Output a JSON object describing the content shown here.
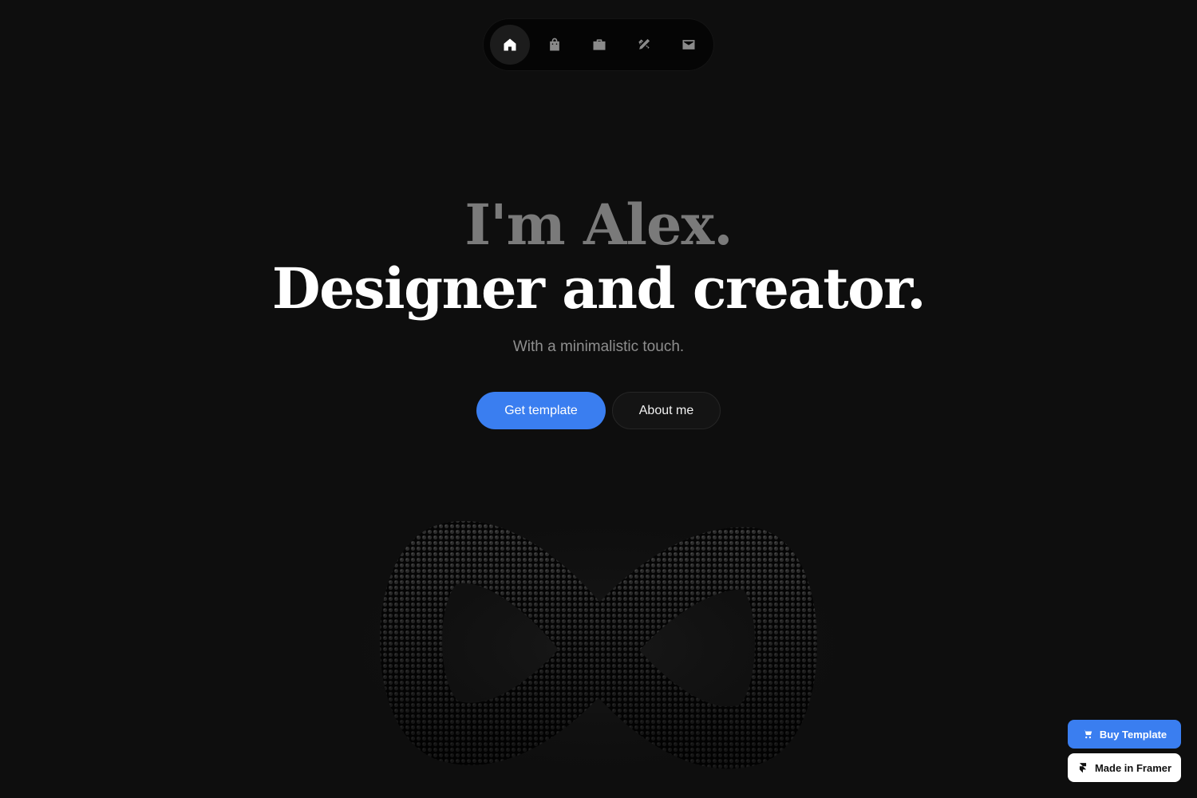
{
  "nav": {
    "items": [
      {
        "icon": "home-icon",
        "active": true
      },
      {
        "icon": "shopping-bag-icon",
        "active": false
      },
      {
        "icon": "briefcase-icon",
        "active": false
      },
      {
        "icon": "pencil-ruler-icon",
        "active": false
      },
      {
        "icon": "mail-icon",
        "active": false
      }
    ]
  },
  "hero": {
    "line1": "I'm Alex.",
    "line2": "Designer and creator.",
    "subtitle": "With a minimalistic touch."
  },
  "cta": {
    "primary_label": "Get template",
    "secondary_label": "About me"
  },
  "badges": {
    "buy_label": "Buy Template",
    "framer_label": "Made in Framer"
  },
  "colors": {
    "background": "#0e0e0e",
    "accent": "#3a7ef0",
    "muted_text": "#7a7a7a"
  }
}
